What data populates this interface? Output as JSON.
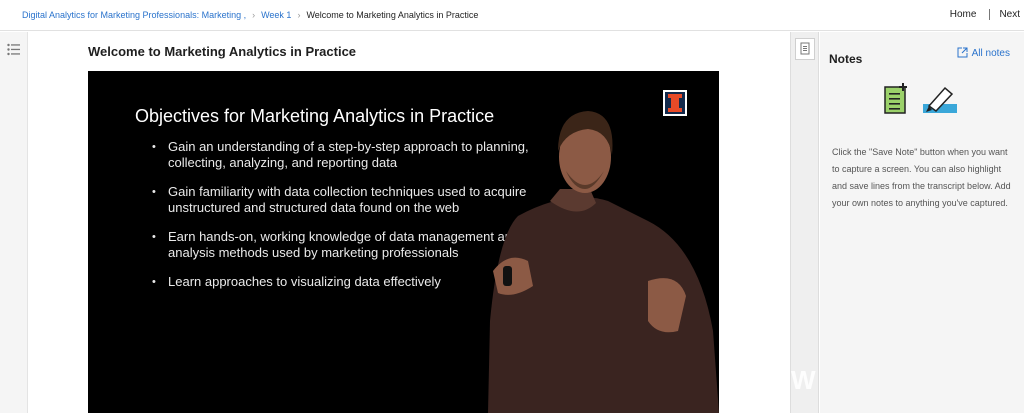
{
  "breadcrumb": {
    "course": "Digital Analytics for Marketing Professionals: Marketing ,",
    "week": "Week 1",
    "current": "Welcome to Marketing Analytics in Practice"
  },
  "topnav": {
    "home": "Home",
    "next": "Next"
  },
  "lecture": {
    "title": "Welcome to Marketing Analytics in Practice"
  },
  "video": {
    "slide_title": "Objectives for Marketing Analytics in Practice",
    "bullets": [
      "Gain an understanding of a step-by-step approach to planning, collecting, analyzing, and reporting data",
      "Gain familiarity with data collection techniques used to acquire unstructured and structured data found on the web",
      "Earn hands-on, working knowledge of data management and analysis methods used by marketing professionals",
      "Learn approaches to visualizing data effectively"
    ],
    "logo_letter": "I"
  },
  "scrollstrip": {
    "watermark": "W"
  },
  "notes": {
    "title": "Notes",
    "all_notes": "All notes",
    "help": "Click the \"Save Note\" button when you want to capture a screen. You can also highlight and save lines from the transcript below. Add your own notes to anything you've captured."
  },
  "colors": {
    "link": "#2a73cc",
    "note_green": "#9bd16a",
    "highlight_blue": "#3aa7d9"
  },
  "icons": [
    "list-icon",
    "transcript-icon",
    "external-link-icon",
    "save-note-icon",
    "highlight-icon",
    "university-logo"
  ]
}
